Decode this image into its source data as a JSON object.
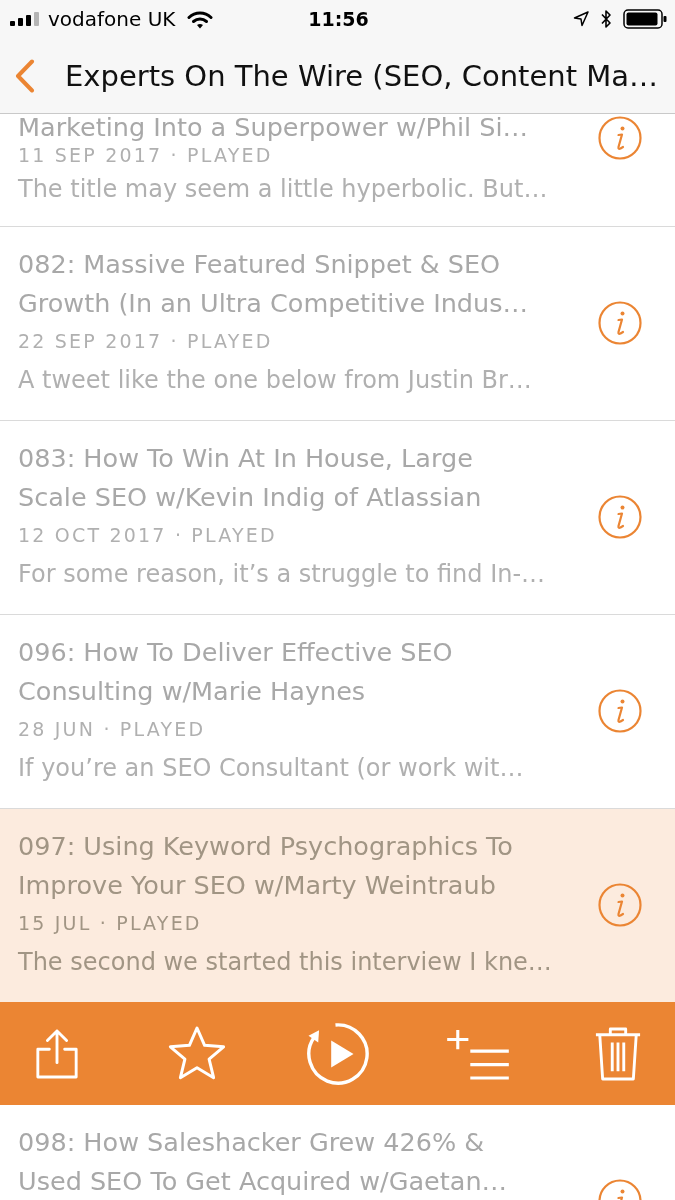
{
  "status_bar": {
    "carrier": "vodafone UK",
    "time": "11:56"
  },
  "nav_bar": {
    "title": "Experts On The Wire (SEO, Content Ma…"
  },
  "episodes": [
    {
      "title": "Marketing Into a Superpower w/Phil Si…",
      "meta": "11 SEP 2017 · PLAYED",
      "excerpt": "The title may seem a little hyperbolic. But…",
      "played": true,
      "selected": false
    },
    {
      "title": "082: Massive Featured Snippet & SEO Growth (In an Ultra Competitive Indus…",
      "meta": "22 SEP 2017 · PLAYED",
      "excerpt": "A tweet like the one below from Justin Br…",
      "played": true,
      "selected": false
    },
    {
      "title": "083: How To Win At In House, Large Scale SEO w/Kevin Indig of Atlassian",
      "meta": "12 OCT 2017 · PLAYED",
      "excerpt": "For some reason, it’s a struggle to find In-…",
      "played": true,
      "selected": false
    },
    {
      "title": "096: How To Deliver Effective SEO Consulting w/Marie Haynes",
      "meta": "28 JUN · PLAYED",
      "excerpt": "If you’re an SEO Consultant (or work wit…",
      "played": true,
      "selected": false
    },
    {
      "title": "097: Using Keyword Psychographics To Improve Your SEO w/Marty Weintraub",
      "meta": "15 JUL · PLAYED",
      "excerpt": "The second we started this interview I kne…",
      "played": true,
      "selected": true
    },
    {
      "title": "098: How Saleshacker Grew 426% & Used SEO To Get Acquired w/Gaetan…",
      "played": true,
      "selected": false
    }
  ]
}
